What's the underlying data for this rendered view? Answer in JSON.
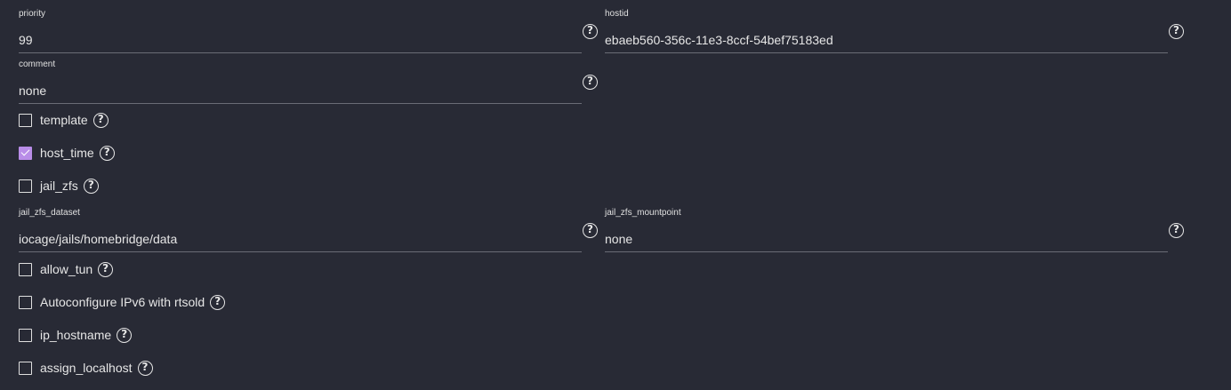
{
  "fields": {
    "priority": {
      "label": "priority",
      "value": "99"
    },
    "hostid": {
      "label": "hostid",
      "value": "ebaeb560-356c-11e3-8ccf-54bef75183ed"
    },
    "comment": {
      "label": "comment",
      "value": "none"
    },
    "jail_zfs_dataset": {
      "label": "jail_zfs_dataset",
      "value": "iocage/jails/homebridge/data"
    },
    "jail_zfs_mountpoint": {
      "label": "jail_zfs_mountpoint",
      "value": "none"
    }
  },
  "checkboxes": {
    "template": {
      "label": "template",
      "checked": false
    },
    "host_time": {
      "label": "host_time",
      "checked": true
    },
    "jail_zfs": {
      "label": "jail_zfs",
      "checked": false
    },
    "allow_tun": {
      "label": "allow_tun",
      "checked": false
    },
    "rtsold": {
      "label": "Autoconfigure IPv6 with rtsold",
      "checked": false
    },
    "ip_hostname": {
      "label": "ip_hostname",
      "checked": false
    },
    "assign_localhost": {
      "label": "assign_localhost",
      "checked": false
    }
  },
  "help_icon": {
    "name": "help-circle-icon",
    "glyph": "?"
  },
  "accent_color": "#b98de8"
}
